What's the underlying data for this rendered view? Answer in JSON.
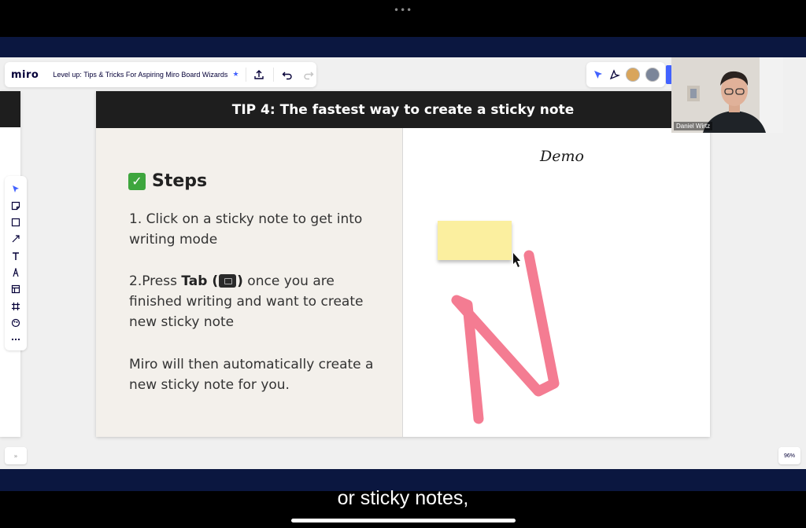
{
  "window": {
    "menu_dots": "•••"
  },
  "miro": {
    "logo": "miro",
    "board_title": "Level up: Tips & Tricks For Aspiring Miro Board Wizards",
    "zoom": "96%",
    "collapse_label": "»"
  },
  "slide": {
    "title": "TIP 4: The fastest way to create a sticky note",
    "steps_heading": "Steps",
    "step1": "1. Click on a sticky note to get into writing mode",
    "step2_prefix": "2.Press ",
    "step2_key": "Tab",
    "step2_suffix": " once you are finished writing and want to create new sticky note",
    "closing": "Miro will then automatically create a new sticky note for you.",
    "demo_label": "Demo"
  },
  "video": {
    "participant_name": "Daniel Wirtz"
  },
  "caption": {
    "text": "or sticky notes,"
  },
  "colors": {
    "header": "#1e1e1e",
    "sticky": "#fbef9f",
    "pen": "#f0506e",
    "band": "#0b1740",
    "accent": "#4262ff"
  }
}
